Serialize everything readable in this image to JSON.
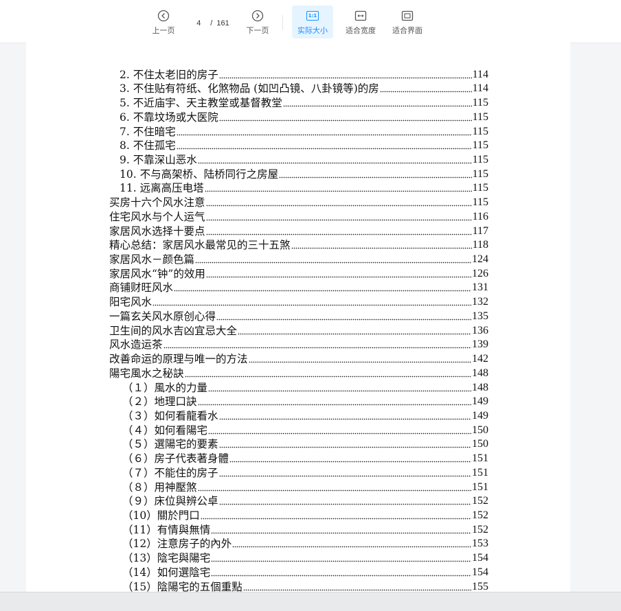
{
  "toolbar": {
    "prev_label": "上一页",
    "next_label": "下一页",
    "current_page": "4",
    "separator": "/",
    "total_pages": "161",
    "actual_size_label": "实际大小",
    "actual_size_icon_text": "1:1",
    "fit_width_label": "适合宽度",
    "fit_page_label": "适合界面"
  },
  "toc": [
    {
      "text": "2. 不住太老旧的房子",
      "page": "114",
      "level": 1
    },
    {
      "text": "3. 不住贴有符纸、化煞物品 (如凹凸镜、八卦镜等)的房",
      "page": "114",
      "level": 1
    },
    {
      "text": "5. 不近庙宇、天主教堂或基督教堂",
      "page": "115",
      "level": 1
    },
    {
      "text": "6. 不靠坟场或大医院",
      "page": "115",
      "level": 1
    },
    {
      "text": "7. 不住暗宅",
      "page": "115",
      "level": 1
    },
    {
      "text": "8. 不住孤宅",
      "page": "115",
      "level": 1
    },
    {
      "text": "9. 不靠深山恶水",
      "page": "115",
      "level": 1
    },
    {
      "text": "10. 不与高架桥、陆桥同行之房屋",
      "page": "115",
      "level": 2
    },
    {
      "text": "11. 远离高压电塔",
      "page": "115",
      "level": 2
    },
    {
      "text": "买房十六个风水注意",
      "page": "115",
      "level": 0
    },
    {
      "text": "住宅风水与个人运气",
      "page": "116",
      "level": 0
    },
    {
      "text": "家居风水选择十要点",
      "page": "117",
      "level": 0
    },
    {
      "text": "精心总结：家居风水最常见的三十五煞",
      "page": "118",
      "level": 0
    },
    {
      "text": "家居风水－颜色篇",
      "page": "124",
      "level": 0
    },
    {
      "text": "家居风水“钟”的效用",
      "page": "126",
      "level": 0
    },
    {
      "text": "商铺财旺风水",
      "page": "131",
      "level": 0
    },
    {
      "text": "阳宅风水",
      "page": "132",
      "level": 0
    },
    {
      "text": "一篇玄关风水原创心得",
      "page": "135",
      "level": 0
    },
    {
      "text": "卫生间的风水吉凶宜忌大全",
      "page": "136",
      "level": 0
    },
    {
      "text": "风水造运茶",
      "page": "139",
      "level": 0
    },
    {
      "text": "改善命运的原理与唯一的方法",
      "page": "142",
      "level": 0
    },
    {
      "text": "陽宅風水之秘訣",
      "page": "148",
      "level": 0
    },
    {
      "text": "（１）風水的力量",
      "page": "148",
      "level": 3
    },
    {
      "text": "（２）地理口訣",
      "page": "149",
      "level": 3
    },
    {
      "text": "（３）如何看龍看水",
      "page": "149",
      "level": 3
    },
    {
      "text": "（４）如何看陽宅",
      "page": "150",
      "level": 3
    },
    {
      "text": "（５）選陽宅的要素",
      "page": "150",
      "level": 3
    },
    {
      "text": "（６）房子代表著身體",
      "page": "151",
      "level": 3
    },
    {
      "text": "（７）不能住的房子",
      "page": "151",
      "level": 3
    },
    {
      "text": "（８）用神壓煞",
      "page": "151",
      "level": 3
    },
    {
      "text": "（９）床位與辨公卓",
      "page": "152",
      "level": 3
    },
    {
      "text": "（10）關於門口",
      "page": "152",
      "level": 3
    },
    {
      "text": "（11）有情與無情",
      "page": "152",
      "level": 3
    },
    {
      "text": "（12）注意房子的內外",
      "page": "153",
      "level": 3
    },
    {
      "text": "（13）陰宅與陽宅",
      "page": "154",
      "level": 3
    },
    {
      "text": "（14）如何選陰宅",
      "page": "154",
      "level": 3
    },
    {
      "text": "（15）陰陽宅的五個重點",
      "page": "155",
      "level": 3
    }
  ]
}
